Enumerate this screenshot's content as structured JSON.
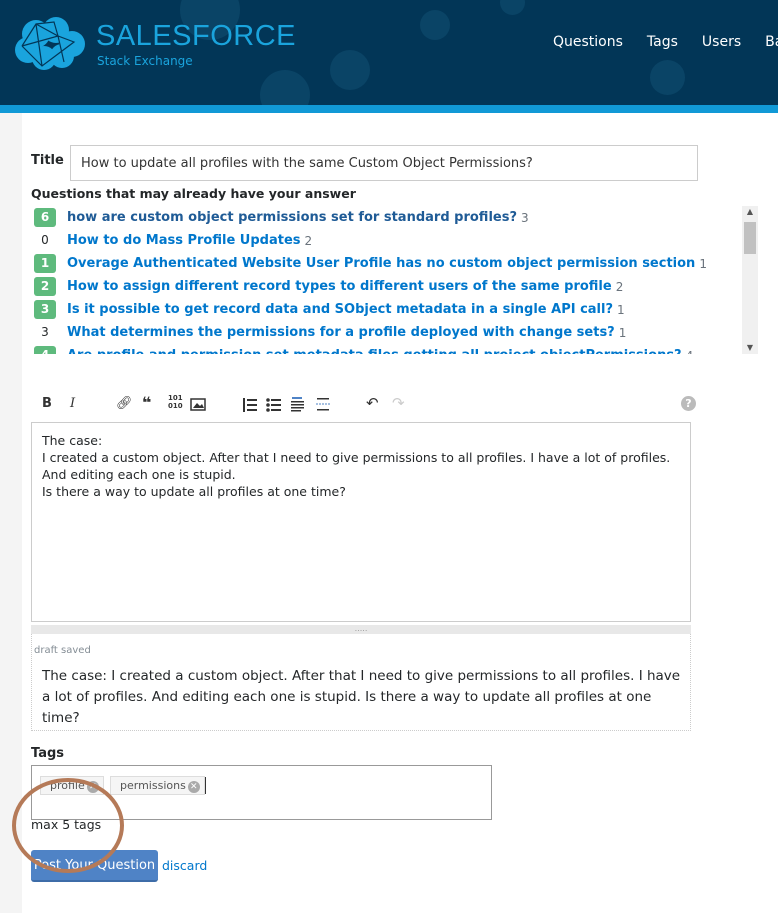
{
  "header": {
    "brand": "SALESFORCE",
    "brand_sub": "Stack Exchange",
    "nav": [
      "Questions",
      "Tags",
      "Users",
      "Badges"
    ]
  },
  "form": {
    "title_label": "Title",
    "title_value": "How to update all profiles with the same Custom Object Permissions?",
    "similar_heading": "Questions that may already have your answer",
    "similar": [
      {
        "votes": "6",
        "answered": true,
        "title": "how are custom object permissions set for standard profiles?",
        "count": "3"
      },
      {
        "votes": "0",
        "answered": false,
        "title": "How to do Mass Profile Updates",
        "count": "2"
      },
      {
        "votes": "1",
        "answered": true,
        "title": "Overage Authenticated Website User Profile has no custom object permission section",
        "count": "1"
      },
      {
        "votes": "2",
        "answered": true,
        "title": "How to assign different record types to different users of the same profile",
        "count": "2"
      },
      {
        "votes": "3",
        "answered": true,
        "title": "Is it possible to get record data and SObject metadata in a single API call?",
        "count": "1"
      },
      {
        "votes": "3",
        "answered": false,
        "title": "What determines the permissions for a profile deployed with change sets?",
        "count": "1"
      },
      {
        "votes": "4",
        "answered": true,
        "title": "Are profile and permission set metadata files getting all project objectPermissions?",
        "count": "4"
      }
    ],
    "toolbar": {
      "bold": "B",
      "italic": "I",
      "code": "101\n010"
    },
    "body": "The case:\nI created a custom object. After that I need to give permissions to all profiles. I have a lot of profiles. And editing each one is stupid.\nIs there a way to update all profiles at one time?",
    "draft_status": "draft saved",
    "preview": "The case: I created a custom object. After that I need to give permissions to all profiles. I have a lot of profiles. And editing each one is stupid. Is there a way to update all profiles at one time?",
    "tags_label": "Tags",
    "tags": [
      "profile",
      "permissions"
    ],
    "tags_hint": "max 5 tags",
    "post_label": "Post Your Question",
    "discard_label": "discard"
  },
  "colors": {
    "header": "#023657",
    "accent_bar": "#1199d6",
    "link": "#0077cc",
    "answered_badge": "#5eba7d",
    "post_button": "#4f83c6",
    "annotation_circle": "#b57a58"
  }
}
